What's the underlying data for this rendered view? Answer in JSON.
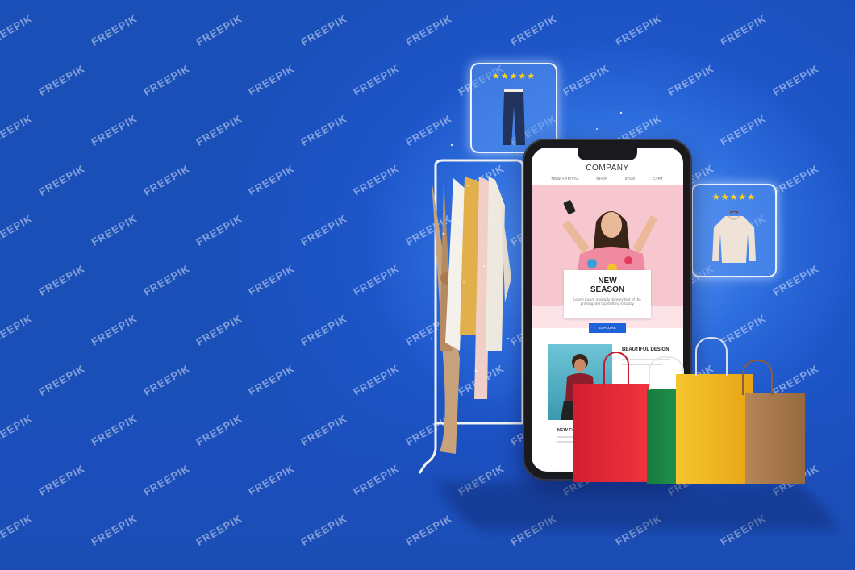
{
  "phone": {
    "brand": "COMPANY",
    "nav": [
      "NEW ARRIVAL",
      "SHOP",
      "SALE",
      "CART"
    ],
    "hero_card": {
      "title": "NEW\nSEASON",
      "body": "Lorem ipsum is simply dummy text of the printing and typesetting industry.",
      "button": "EXPLORE"
    },
    "section2_title": "BEAUTIFUL DESIGN",
    "section3_title": "NEW COL"
  },
  "tiles": [
    {
      "name": "jeans",
      "rating": "★★★★★"
    },
    {
      "name": "sweater",
      "rating": "★★★★★"
    }
  ],
  "watermark": "FREEPIK",
  "colors": {
    "background": "#1d55c8",
    "accent_button": "#1e62d8",
    "hero_pink": "#f7c7d0",
    "bag_red": "#e8283a",
    "bag_green": "#1f8a4a",
    "bag_yellow": "#f2b322",
    "bag_brown": "#a87a52"
  }
}
